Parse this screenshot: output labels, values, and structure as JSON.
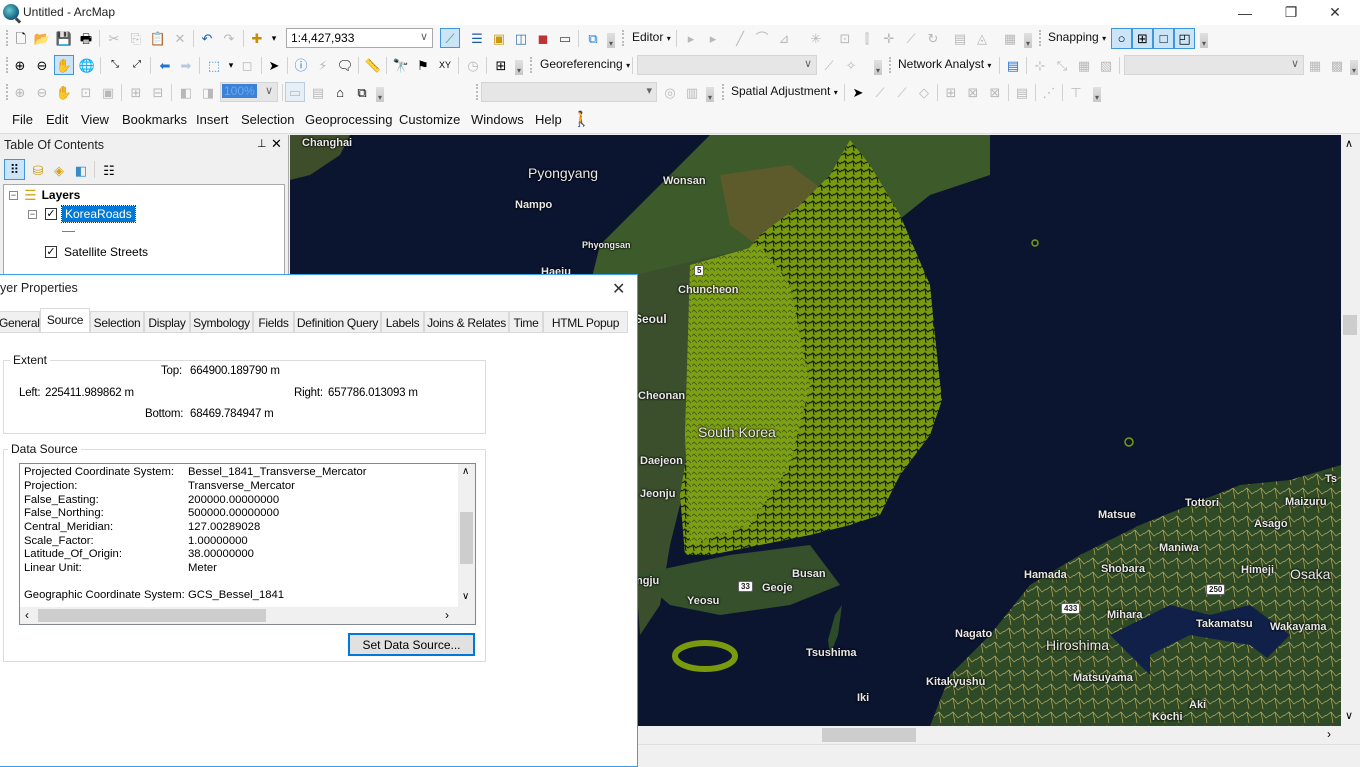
{
  "window": {
    "title": "Untitled - ArcMap",
    "controls": {
      "minimize": "—",
      "restore": "❐",
      "close": "✕"
    }
  },
  "toolbar": {
    "scale_value": "1:4,427,933",
    "editor_label": "Editor",
    "snapping_label": "Snapping",
    "georeferencing_label": "Georeferencing",
    "network_analyst_label": "Network Analyst",
    "spatial_adjustment_label": "Spatial Adjustment",
    "layout_zoom_value": "100%",
    "dropdown_arrow": "▾",
    "combo_arrow": "∨"
  },
  "menu": {
    "items": [
      "File",
      "Edit",
      "View",
      "Bookmarks",
      "Insert",
      "Selection",
      "Geoprocessing",
      "Customize",
      "Windows",
      "Help"
    ]
  },
  "toc": {
    "title": "Table Of Contents",
    "pin": "📌",
    "close": "✕",
    "layers_group": "Layers",
    "layers": [
      {
        "name": "KoreaRoads",
        "checked": true,
        "selected": true
      },
      {
        "name": "Satellite Streets",
        "checked": true,
        "selected": false
      }
    ],
    "symbol_color": "#8a8a1e"
  },
  "map": {
    "labels": [
      {
        "text": "Changhai"
      },
      {
        "text": "Pyongyang"
      },
      {
        "text": "Wonsan"
      },
      {
        "text": "Nampo"
      },
      {
        "text": "Phyongsan"
      },
      {
        "text": "Haeju"
      },
      {
        "text": "Chuncheon"
      },
      {
        "text": "Seoul"
      },
      {
        "text": "Cheonan"
      },
      {
        "text": "South Korea"
      },
      {
        "text": "Daejeon"
      },
      {
        "text": "Jeonju"
      },
      {
        "text": "Busan"
      },
      {
        "text": "Geoje"
      },
      {
        "text": "Yeosu"
      },
      {
        "text": "Gwangju"
      },
      {
        "text": "Tsushima"
      },
      {
        "text": "Iki"
      },
      {
        "text": "Kitakyushu"
      },
      {
        "text": "Nagato"
      },
      {
        "text": "Hamada"
      },
      {
        "text": "Matsue"
      },
      {
        "text": "Tottori"
      },
      {
        "text": "Maizuru"
      },
      {
        "text": "Asago"
      },
      {
        "text": "Maniwa"
      },
      {
        "text": "Shobara"
      },
      {
        "text": "Himeji"
      },
      {
        "text": "Osaka"
      },
      {
        "text": "Mihara"
      },
      {
        "text": "Hiroshima"
      },
      {
        "text": "Takamatsu"
      },
      {
        "text": "Wakayama"
      },
      {
        "text": "Matsuyama"
      },
      {
        "text": "Aki"
      },
      {
        "text": "Kochi"
      },
      {
        "text": "Ts"
      }
    ],
    "shields": [
      "33",
      "433",
      "250",
      "5"
    ],
    "roads_color": "#7a9a0e",
    "sea_color": "#0c1630"
  },
  "dialog": {
    "title": "yer Properties",
    "close": "✕",
    "tabs": [
      "General",
      "Source",
      "Selection",
      "Display",
      "Symbology",
      "Fields",
      "Definition Query",
      "Labels",
      "Joins & Relates",
      "Time",
      "HTML Popup"
    ],
    "active_tab": "Source",
    "extent": {
      "title": "Extent",
      "top_label": "Top:",
      "top": "664900.189790 m",
      "left_label": "Left:",
      "left": "225411.989862 m",
      "right_label": "Right:",
      "right": "657786.013093 m",
      "bottom_label": "Bottom:",
      "bottom": "68469.784947 m"
    },
    "data_source": {
      "title": "Data Source",
      "rows": [
        {
          "key": "Projected Coordinate System:",
          "value": "Bessel_1841_Transverse_Mercator"
        },
        {
          "key": "Projection:",
          "value": "Transverse_Mercator"
        },
        {
          "key": "False_Easting:",
          "value": "200000.00000000"
        },
        {
          "key": "False_Northing:",
          "value": "500000.00000000"
        },
        {
          "key": "Central_Meridian:",
          "value": "127.00289028"
        },
        {
          "key": "Scale_Factor:",
          "value": "1.00000000"
        },
        {
          "key": "Latitude_Of_Origin:",
          "value": "38.00000000"
        },
        {
          "key": "Linear Unit:",
          "value": "Meter"
        },
        {
          "key": "",
          "value": ""
        },
        {
          "key": "Geographic Coordinate System:",
          "value": "GCS_Bessel_1841"
        }
      ],
      "button": "Set Data Source..."
    }
  }
}
